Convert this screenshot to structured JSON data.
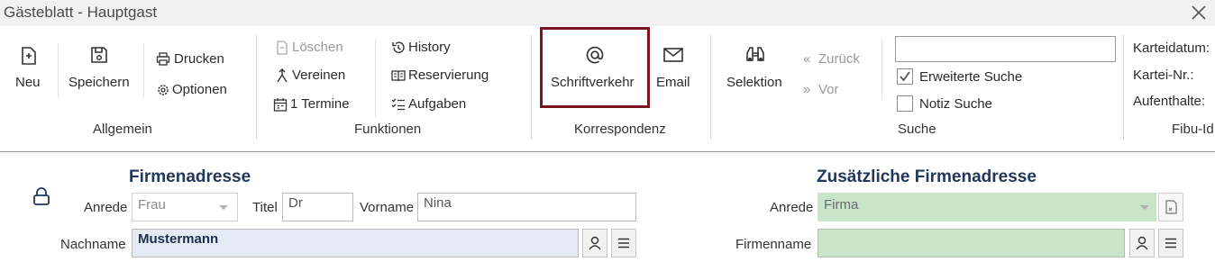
{
  "window": {
    "title": "Gästeblatt - Hauptgast"
  },
  "ribbon": {
    "allgemein": {
      "group_label": "Allgemein",
      "neu": "Neu",
      "speichern": "Speichern",
      "drucken": "Drucken",
      "optionen": "Optionen"
    },
    "funktionen": {
      "group_label": "Funktionen",
      "loeschen": "Löschen",
      "vereinen": "Vereinen",
      "termine": "1 Termine",
      "history": "History",
      "reservierung": "Reservierung",
      "aufgaben": "Aufgaben"
    },
    "korrespondenz": {
      "group_label": "Korrespondenz",
      "schriftverkehr": "Schriftverkehr",
      "email": "Email"
    },
    "suche": {
      "group_label": "Suche",
      "selektion": "Selektion",
      "zurueck": "Zurück",
      "vor": "Vor",
      "search_value": "",
      "erweiterte_suche": "Erweiterte Suche",
      "erweiterte_suche_checked": true,
      "notiz_suche": "Notiz Suche",
      "notiz_suche_checked": false
    },
    "info": {
      "karteidatum": "Karteidatum:",
      "kartei_nr": "Kartei-Nr.:",
      "aufenthalte": "Aufenthalte:",
      "fibu_id": "Fibu-Id"
    }
  },
  "firmenadresse": {
    "heading": "Firmenadresse",
    "anrede_label": "Anrede",
    "anrede_value": "Frau",
    "titel_label": "Titel",
    "titel_value": "Dr",
    "vorname_label": "Vorname",
    "vorname_value": "Nina",
    "nachname_label": "Nachname",
    "nachname_value": "Mustermann"
  },
  "zusaetzliche": {
    "heading": "Zusätzliche Firmenadresse",
    "anrede_label": "Anrede",
    "anrede_value": "Firma",
    "firmenname_label": "Firmenname",
    "firmenname_value": ""
  },
  "colors": {
    "highlight": "#7b1420",
    "heading": "#22375a",
    "green_field": "#c9e5c9",
    "blue_field": "#e4ebf4"
  }
}
